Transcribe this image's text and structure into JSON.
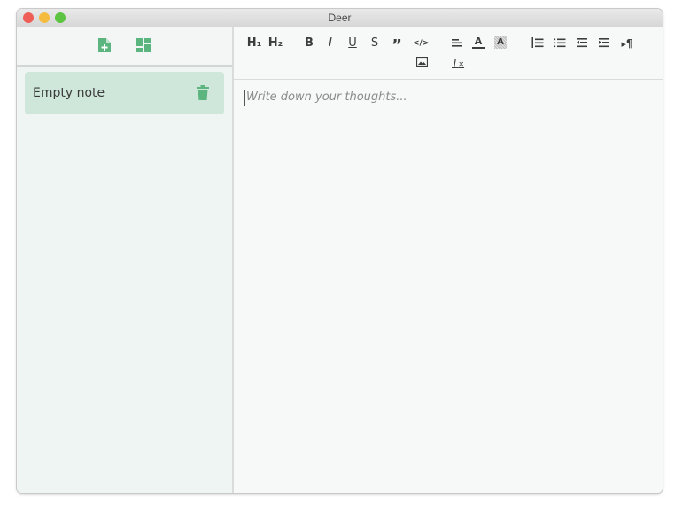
{
  "window": {
    "title": "Deer"
  },
  "sidebar": {
    "header_icons": [
      "new-note-icon",
      "layout-icon"
    ],
    "notes": [
      {
        "title": "Empty note",
        "selected": true
      }
    ]
  },
  "toolbar": {
    "buttons": [
      {
        "name": "heading-1",
        "label": "H₁"
      },
      {
        "name": "heading-2",
        "label": "H₂"
      },
      {
        "name": "bold",
        "label": "B"
      },
      {
        "name": "italic",
        "label": "I"
      },
      {
        "name": "underline",
        "label": "U"
      },
      {
        "name": "strikethrough",
        "label": "S"
      },
      {
        "name": "blockquote",
        "label": "”"
      },
      {
        "name": "code-block",
        "label": "</>"
      },
      {
        "name": "align",
        "label": ""
      },
      {
        "name": "text-color",
        "label": "A"
      },
      {
        "name": "background-color",
        "label": "A"
      },
      {
        "name": "ordered-list",
        "label": ""
      },
      {
        "name": "bullet-list",
        "label": ""
      },
      {
        "name": "outdent",
        "label": ""
      },
      {
        "name": "indent",
        "label": ""
      },
      {
        "name": "text-direction",
        "label": "¶"
      },
      {
        "name": "image",
        "label": ""
      },
      {
        "name": "clear-formatting",
        "label": "T"
      }
    ]
  },
  "editor": {
    "placeholder": "Write down your thoughts..."
  },
  "colors": {
    "accent": "#5cb57e",
    "note_selected_bg": "#cfe7da",
    "sidebar_bg": "#eff5f2"
  }
}
